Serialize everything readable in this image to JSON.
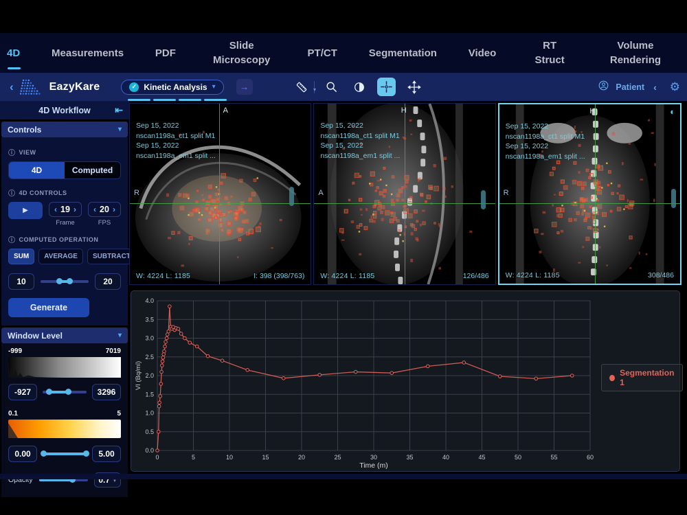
{
  "nav": {
    "items": [
      {
        "label": "4D",
        "active": true
      },
      {
        "label": "Measurements"
      },
      {
        "label": "PDF"
      },
      {
        "label": "Slide Microscopy"
      },
      {
        "label": "PT/CT"
      },
      {
        "label": "Segmentation"
      },
      {
        "label": "Video"
      },
      {
        "label": "RT Struct"
      },
      {
        "label": "Volume Rendering"
      }
    ]
  },
  "toolbar": {
    "brand": "EazyKare",
    "back_glyph": "‹",
    "workflow": {
      "value": "Kinetic Analysis",
      "status_glyph": "✓",
      "chevron_glyph": "▾",
      "go_glyph": "→"
    },
    "progress_segments": 4,
    "patient_label": "Patient",
    "patient_chevron_glyph": "‹",
    "gear_glyph": "⚙"
  },
  "sidebar": {
    "title": "4D Workflow",
    "collapse_glyph": "⇤",
    "controls": {
      "header": "Controls",
      "chevron_glyph": "▾",
      "info_glyph": "ⓘ",
      "view_label": "VIEW",
      "view_options": [
        {
          "label": "4D",
          "active": true
        },
        {
          "label": "Computed",
          "active": false
        }
      ],
      "controls_label": "4D CONTROLS",
      "play_glyph": "▶",
      "frame": {
        "value": "19",
        "label": "Frame",
        "prev_glyph": "‹",
        "next_glyph": "›"
      },
      "fps": {
        "value": "20",
        "label": "FPS",
        "prev_glyph": "‹",
        "next_glyph": "›"
      },
      "computed_label": "COMPUTED OPERATION",
      "operations": [
        {
          "label": "SUM",
          "active": true
        },
        {
          "label": "AVERAGE",
          "active": false
        },
        {
          "label": "SUBTRACT",
          "active": false
        }
      ],
      "range": {
        "from": "10",
        "to": "20"
      },
      "generate_label": "Generate"
    },
    "window_level": {
      "header": "Window Level",
      "chevron_glyph": "▾",
      "hist_min": "-999",
      "hist_max": "7019",
      "level_low": "-927",
      "level_high": "3296",
      "color_min": "0.1",
      "color_max": "5",
      "color_low": "0.00",
      "color_high": "5.00",
      "opacity_label": "Opacity",
      "opacity_value": "0.7",
      "spin_up_glyph": "▲",
      "spin_down_glyph": "▼"
    }
  },
  "viewports": [
    {
      "annotations": [
        "Sep 15, 2022",
        "nscan1198a_ct1 split M1",
        "Sep 15, 2022",
        "nscan1198a_em1 split ..."
      ],
      "orientation_top": "A",
      "orientation_left": "R",
      "wl_text": "W: 4224  L: 1185",
      "index_text": "I: 398 (398/763)",
      "active": false
    },
    {
      "annotations": [
        "Sep 15, 2022",
        "nscan1198a_ct1 split M1",
        "Sep 15, 2022",
        "nscan1198a_em1 split ..."
      ],
      "orientation_top": "H",
      "orientation_left": "A",
      "wl_text": "W: 4224  L: 1185",
      "index_text": "126/486",
      "active": false
    },
    {
      "annotations": [
        "Sep 15, 2022",
        "nscan1198a_ct1 split M1",
        "Sep 15, 2022",
        "nscan1198a_em1 split ..."
      ],
      "orientation_top": "H",
      "orientation_left": "R",
      "wl_text": "W: 4224  L: 1185",
      "index_text": "308/486",
      "active": true,
      "contrast_icon_glyph": "◐"
    }
  ],
  "colors": {
    "accent_cyan": "#4fc3f7",
    "toolbar_blue": "#16255e",
    "sidebar_navy": "#0a1136",
    "button_blue": "#1d46b0",
    "crosshair_green": "#48a248",
    "annotation_teal": "#7ccadd",
    "series_red": "#e2635a"
  },
  "chart_data": {
    "type": "line",
    "title": "",
    "xlabel": "Time (m)",
    "ylabel": "VI (Bq/ml)",
    "xlim": [
      0,
      60
    ],
    "ylim": [
      0,
      4
    ],
    "xticks": [
      0,
      5,
      10,
      15,
      20,
      25,
      30,
      35,
      40,
      45,
      50,
      55,
      60
    ],
    "yticks": [
      0,
      0.5,
      1,
      1.5,
      2,
      2.5,
      3,
      3.5,
      4
    ],
    "grid": true,
    "legend_position": "right",
    "series": [
      {
        "name": "Segmentation 1",
        "color": "#e2635a",
        "points": [
          [
            0,
            0
          ],
          [
            0.17,
            0.5
          ],
          [
            0.25,
            1.18
          ],
          [
            0.3,
            1.28
          ],
          [
            0.4,
            1.45
          ],
          [
            0.5,
            1.78
          ],
          [
            0.58,
            2.1
          ],
          [
            0.65,
            2.27
          ],
          [
            0.72,
            2.38
          ],
          [
            0.8,
            2.48
          ],
          [
            0.88,
            2.57
          ],
          [
            0.95,
            2.65
          ],
          [
            1.05,
            2.78
          ],
          [
            1.15,
            2.9
          ],
          [
            1.3,
            3.0
          ],
          [
            1.4,
            3.1
          ],
          [
            1.55,
            3.18
          ],
          [
            1.7,
            3.85
          ],
          [
            1.85,
            3.3
          ],
          [
            2.0,
            3.25
          ],
          [
            2.2,
            3.3
          ],
          [
            2.4,
            3.22
          ],
          [
            2.6,
            3.27
          ],
          [
            2.9,
            3.25
          ],
          [
            3.3,
            3.12
          ],
          [
            3.8,
            3.0
          ],
          [
            4.5,
            2.88
          ],
          [
            5.5,
            2.78
          ],
          [
            7,
            2.52
          ],
          [
            9,
            2.4
          ],
          [
            12.5,
            2.15
          ],
          [
            17.5,
            1.93
          ],
          [
            22.5,
            2.02
          ],
          [
            27.5,
            2.1
          ],
          [
            32.5,
            2.07
          ],
          [
            37.5,
            2.25
          ],
          [
            42.5,
            2.35
          ],
          [
            47.5,
            1.98
          ],
          [
            52.5,
            1.92
          ],
          [
            57.5,
            2.0
          ]
        ]
      }
    ]
  }
}
